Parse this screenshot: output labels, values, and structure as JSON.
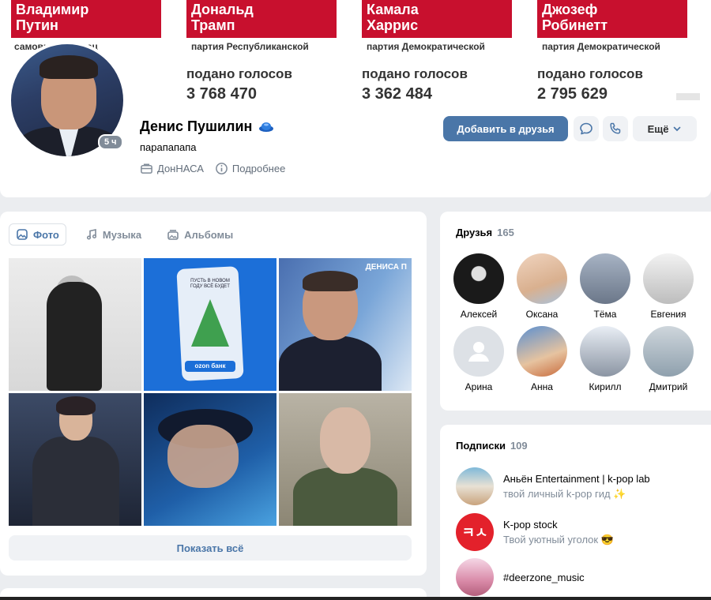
{
  "cover": {
    "candidates": [
      {
        "first": "Владимир",
        "last": "Путин",
        "party": "самовыдвиженец",
        "votes_label": "",
        "votes": ""
      },
      {
        "first": "Дональд",
        "last": "Трамп",
        "party": "партия Республиканской",
        "votes_label": "подано голосов",
        "votes": "3 768 470"
      },
      {
        "first": "Камала",
        "last": "Харрис",
        "party": "партия Демократической",
        "votes_label": "подано голосов",
        "votes": "3 362 484"
      },
      {
        "first": "Джозеф",
        "last": "Робинетт",
        "party": "партия Демократической",
        "votes_label": "подано голосов",
        "votes": "2 795 629"
      }
    ]
  },
  "profile": {
    "name": "Денис Пушилин",
    "status": "парапапапа",
    "online_badge": "5 ч",
    "work": "ДонНАСА",
    "more_info": "Подробнее",
    "add_friend": "Добавить в друзья",
    "more_button": "Ещё"
  },
  "media": {
    "tabs": [
      {
        "label": "Фото",
        "icon": "photo-icon",
        "active": true
      },
      {
        "label": "Музыка",
        "icon": "music-icon",
        "active": false
      },
      {
        "label": "Альбомы",
        "icon": "albums-icon",
        "active": false
      }
    ],
    "photo3_caption": "ДЕНИСА П",
    "photo2_card_text": "ПУСТЬ В НОВОМ ГОДУ ВСЁ БУДЕТ",
    "photo2_brand": "ozon банк",
    "show_all": "Показать всё"
  },
  "friends": {
    "title": "Друзья",
    "count": "165",
    "items": [
      {
        "name": "Алексей"
      },
      {
        "name": "Оксана"
      },
      {
        "name": "Тёма"
      },
      {
        "name": "Евгения"
      },
      {
        "name": "Арина"
      },
      {
        "name": "Анна"
      },
      {
        "name": "Кирилл"
      },
      {
        "name": "Дмитрий"
      }
    ]
  },
  "subscriptions": {
    "title": "Подписки",
    "count": "109",
    "items": [
      {
        "name": "Аньён Entertainment | k-pop lab",
        "desc": "твой личный k-pop гид ✨"
      },
      {
        "name": "K-pop stock",
        "desc": "Твой уютный уголок 😎",
        "logo_text": "ㅋㅅ"
      },
      {
        "name": "#deerzone_music",
        "desc": ""
      }
    ]
  },
  "colors": {
    "accent": "#4a76a8",
    "page_bg": "#ebedf0",
    "muted_text": "#818c99",
    "cover_red": "#c8102e"
  }
}
